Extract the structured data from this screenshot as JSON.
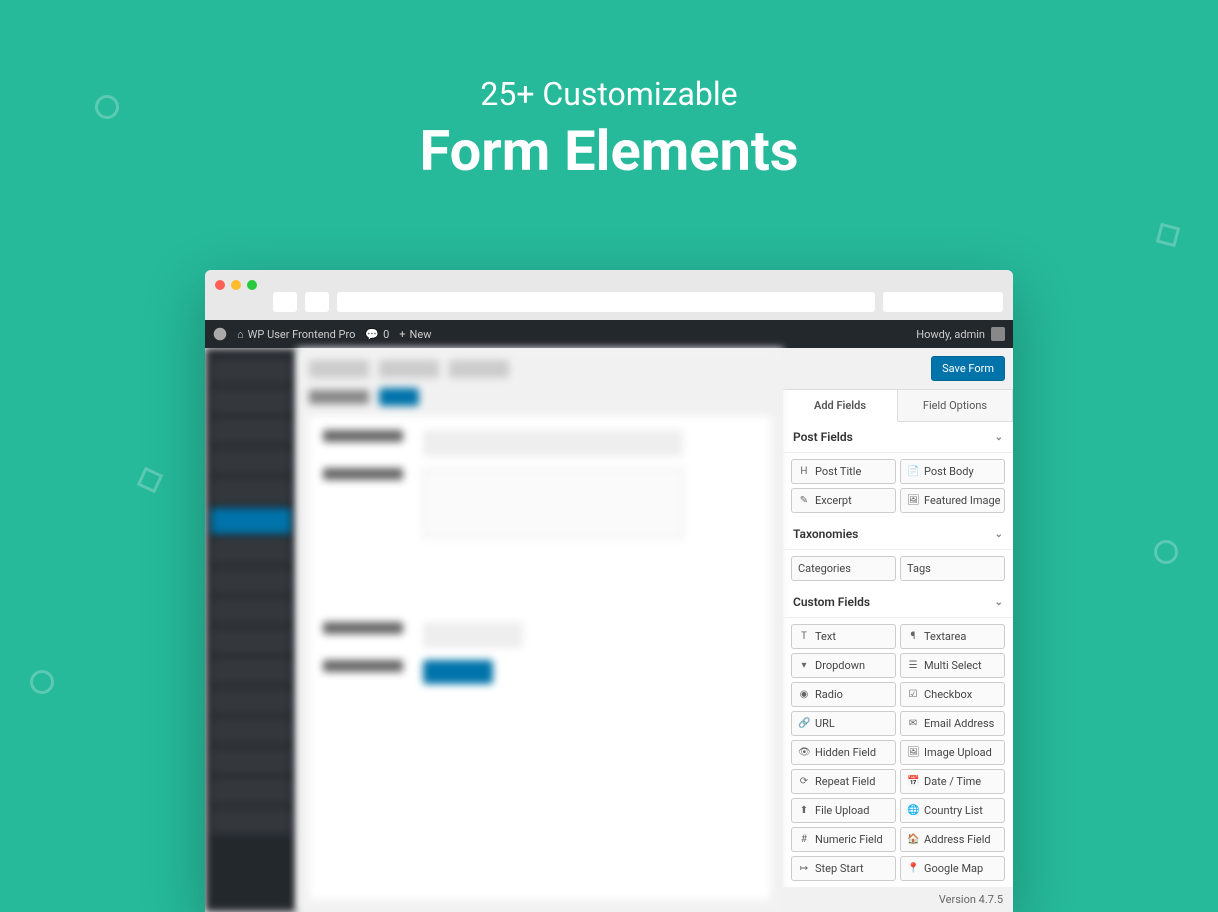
{
  "hero": {
    "subtitle": "25+ Customizable",
    "title": "Form Elements"
  },
  "wp_bar": {
    "site": "WP User Frontend Pro",
    "comments_count": "0",
    "new_label": "New",
    "greeting": "Howdy, admin"
  },
  "panel": {
    "save_label": "Save Form",
    "tabs": {
      "add_fields": "Add Fields",
      "field_options": "Field Options"
    }
  },
  "sections": {
    "post_fields": {
      "title": "Post Fields",
      "items": [
        {
          "icon": "H",
          "label": "Post Title"
        },
        {
          "icon": "📄",
          "label": "Post Body"
        },
        {
          "icon": "✎",
          "label": "Excerpt"
        },
        {
          "icon": "🖼",
          "label": "Featured Image"
        }
      ]
    },
    "taxonomies": {
      "title": "Taxonomies",
      "items": [
        {
          "icon": "",
          "label": "Categories"
        },
        {
          "icon": "",
          "label": "Tags"
        }
      ]
    },
    "custom_fields": {
      "title": "Custom Fields",
      "items": [
        {
          "icon": "T",
          "label": "Text"
        },
        {
          "icon": "¶",
          "label": "Textarea"
        },
        {
          "icon": "▾",
          "label": "Dropdown"
        },
        {
          "icon": "☰",
          "label": "Multi Select"
        },
        {
          "icon": "◉",
          "label": "Radio"
        },
        {
          "icon": "☑",
          "label": "Checkbox"
        },
        {
          "icon": "🔗",
          "label": "URL"
        },
        {
          "icon": "✉",
          "label": "Email Address"
        },
        {
          "icon": "👁",
          "label": "Hidden Field"
        },
        {
          "icon": "🖼",
          "label": "Image Upload"
        },
        {
          "icon": "⟳",
          "label": "Repeat Field"
        },
        {
          "icon": "📅",
          "label": "Date / Time"
        },
        {
          "icon": "⬆",
          "label": "File Upload"
        },
        {
          "icon": "🌐",
          "label": "Country List"
        },
        {
          "icon": "#",
          "label": "Numeric Field"
        },
        {
          "icon": "🏠",
          "label": "Address Field"
        },
        {
          "icon": "↦",
          "label": "Step Start"
        },
        {
          "icon": "📍",
          "label": "Google Map"
        }
      ]
    }
  },
  "footer": {
    "version": "Version 4.7.5"
  }
}
